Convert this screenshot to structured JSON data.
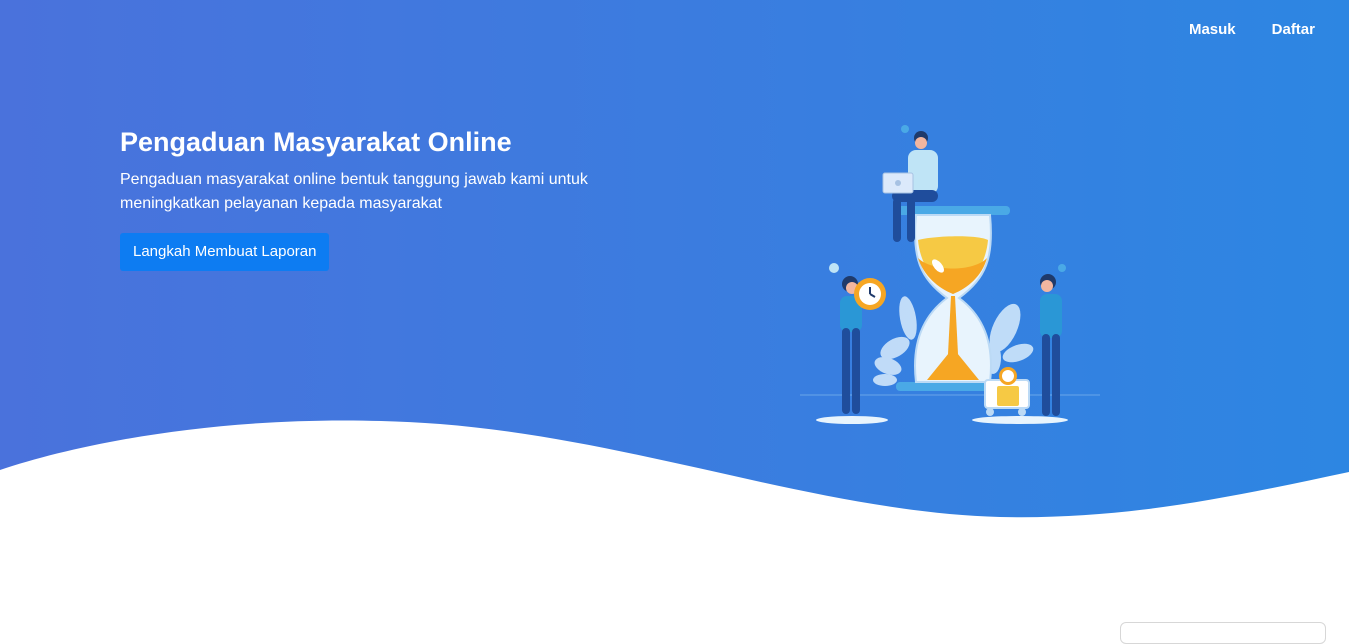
{
  "nav": {
    "login_label": "Masuk",
    "register_label": "Daftar"
  },
  "hero": {
    "title": "Pengaduan Masyarakat Online",
    "subtitle": "Pengaduan masyarakat online bentuk tanggung jawab kami untuk meningkatkan pelayanan kepada masyarakat",
    "cta_label": "Langkah Membuat Laporan"
  },
  "colors": {
    "gradient_start": "#4a72dc",
    "gradient_end": "#2d86e2",
    "button": "#0d7cf2",
    "hourglass_sand": "#f6a623",
    "figure_shirt": "#2a97d6",
    "figure_pants": "#1f4d9c"
  },
  "illustration": {
    "subject": "hourglass-with-people-illustration"
  }
}
